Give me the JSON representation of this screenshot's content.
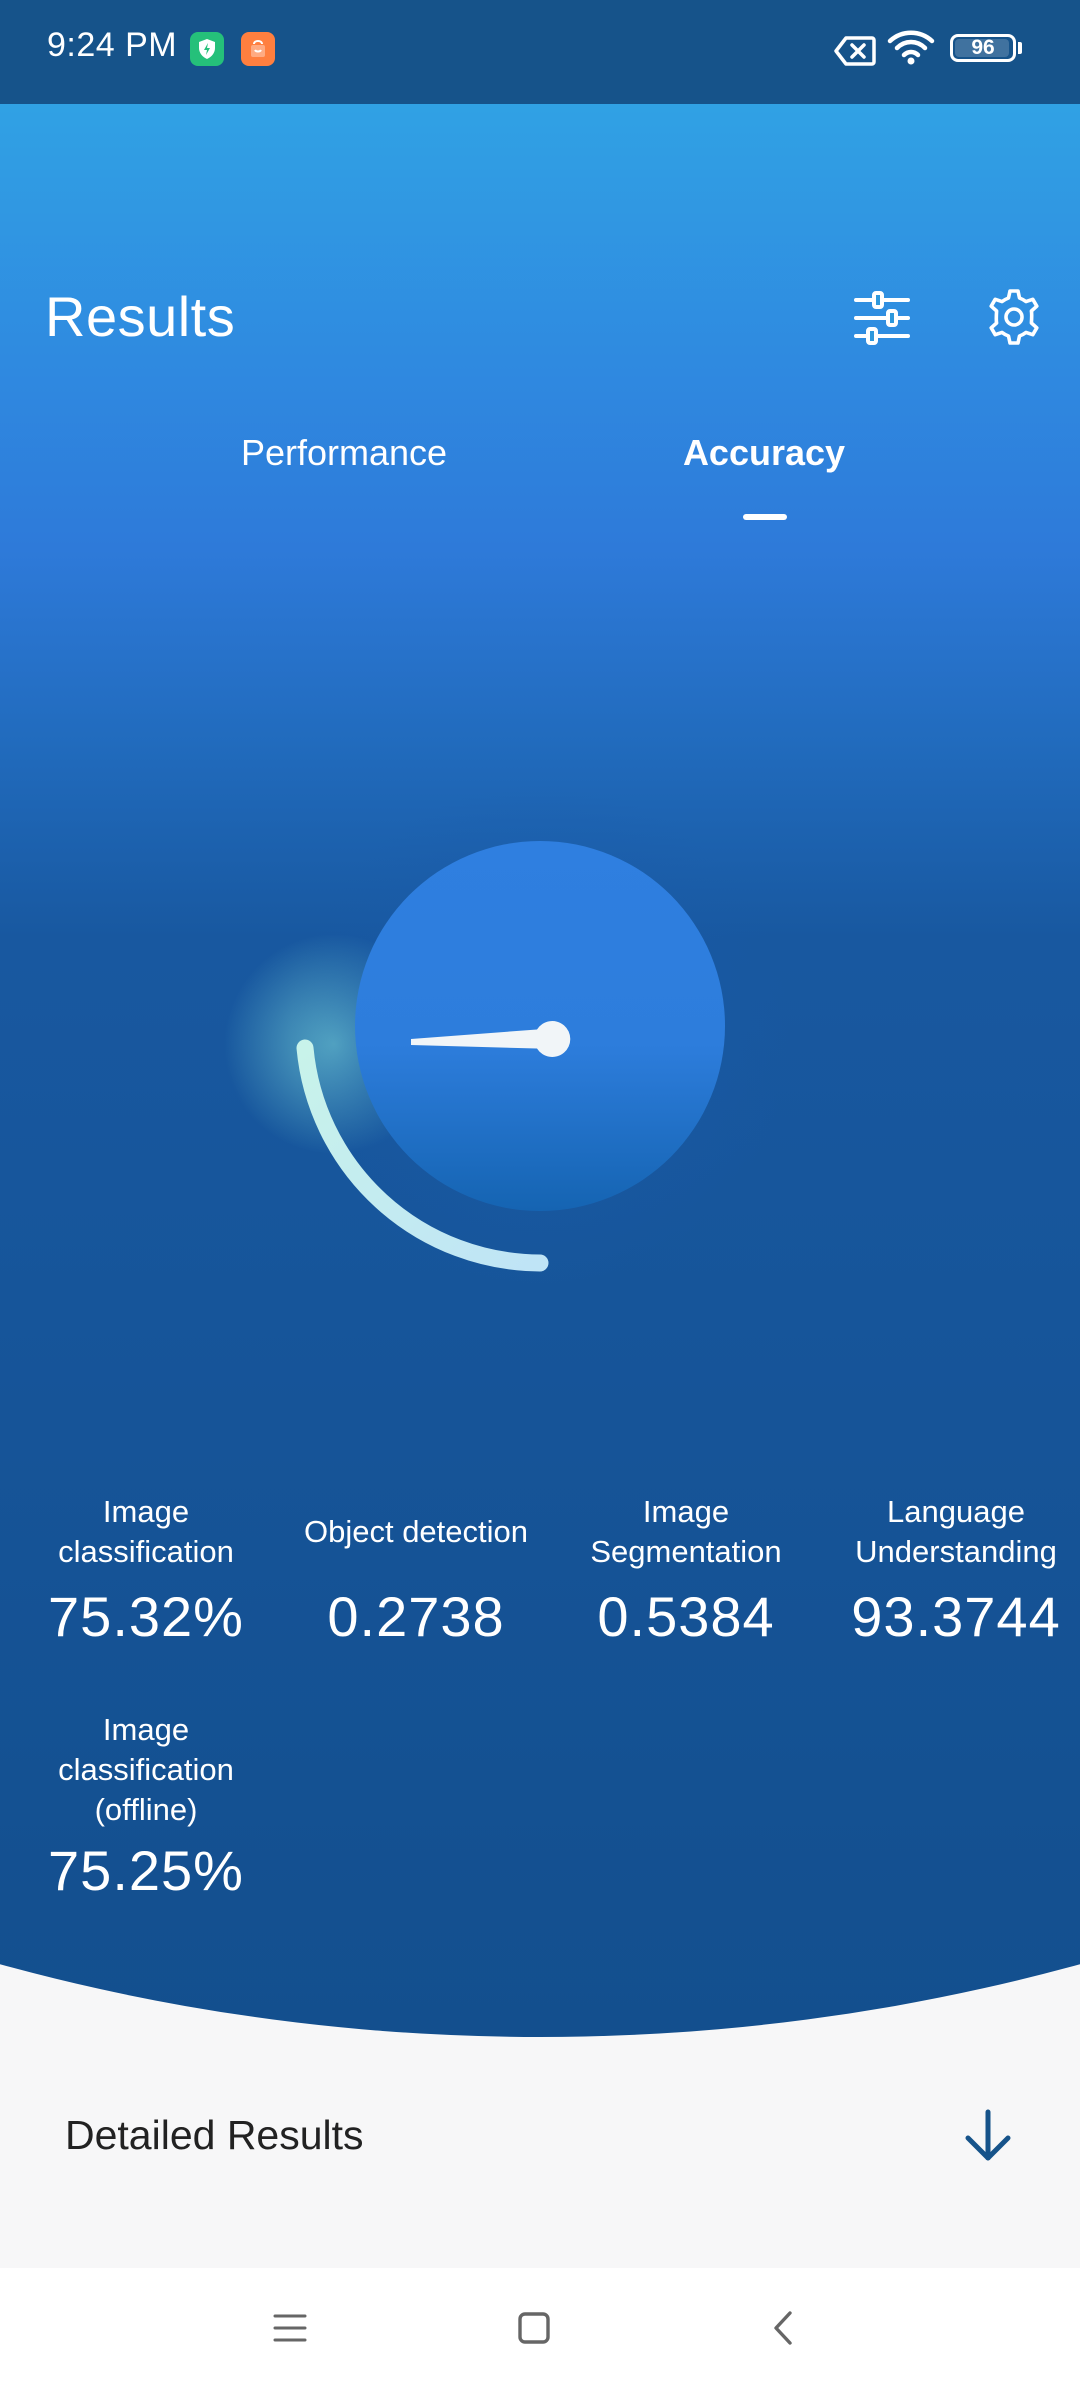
{
  "status_bar": {
    "time": "9:24 PM",
    "battery": "96",
    "icons": [
      "shield-notification-icon",
      "store-notification-icon",
      "no-sim-icon",
      "wifi-icon",
      "battery-icon"
    ]
  },
  "header": {
    "title": "Results",
    "filter_icon": "sliders-icon",
    "settings_icon": "gear-icon"
  },
  "tabs": [
    {
      "label": "Performance",
      "selected": false
    },
    {
      "label": "Accuracy",
      "selected": true
    }
  ],
  "metrics": [
    {
      "label": "Image classification",
      "value": "75.32%"
    },
    {
      "label": "Object detection",
      "value": "0.2738"
    },
    {
      "label": "Image Segmentation",
      "value": "0.5384"
    },
    {
      "label": "Language Understanding",
      "value": "93.3744"
    },
    {
      "label": "Image classification (offline)",
      "value": "75.25%"
    }
  ],
  "details": {
    "label": "Detailed Results",
    "icon": "arrow-down-icon"
  },
  "nav_bar": {
    "icons": [
      "menu-icon",
      "home-icon",
      "back-icon"
    ]
  },
  "colors": {
    "status_bar": "#16538a",
    "gradient_top": "#30a4e4",
    "gradient_mid": "#2e7ad9",
    "gradient_bottom": "#134f8e",
    "details_bg": "#f7f7f8",
    "arrow": "#16538a"
  }
}
